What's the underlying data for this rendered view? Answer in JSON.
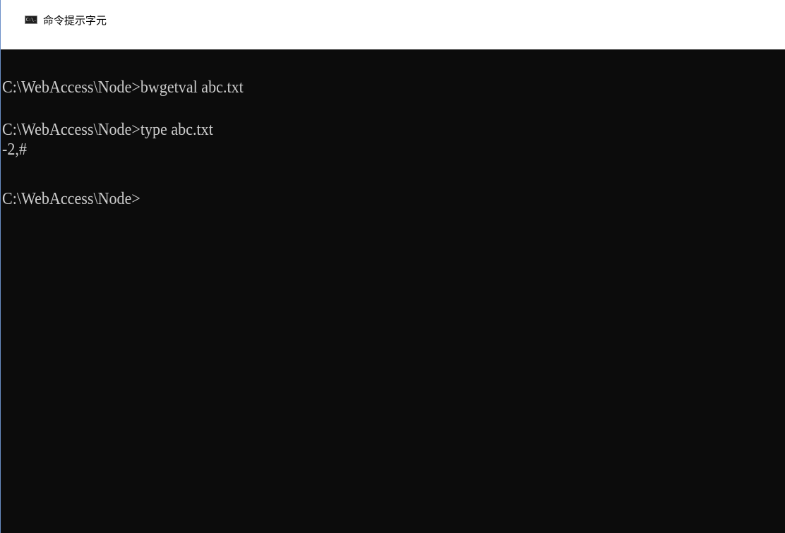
{
  "window": {
    "title": "命令提示字元",
    "icon": "console-icon",
    "icon_glyph": "C:\\."
  },
  "console": {
    "lines": [
      "C:\\WebAccess\\Node>bwgetval abc.txt",
      "",
      "C:\\WebAccess\\Node>type abc.txt",
      "-2,#",
      "",
      "C:\\WebAccess\\Node>"
    ],
    "background_color": "#0c0c0c",
    "text_color": "#cccccc"
  }
}
